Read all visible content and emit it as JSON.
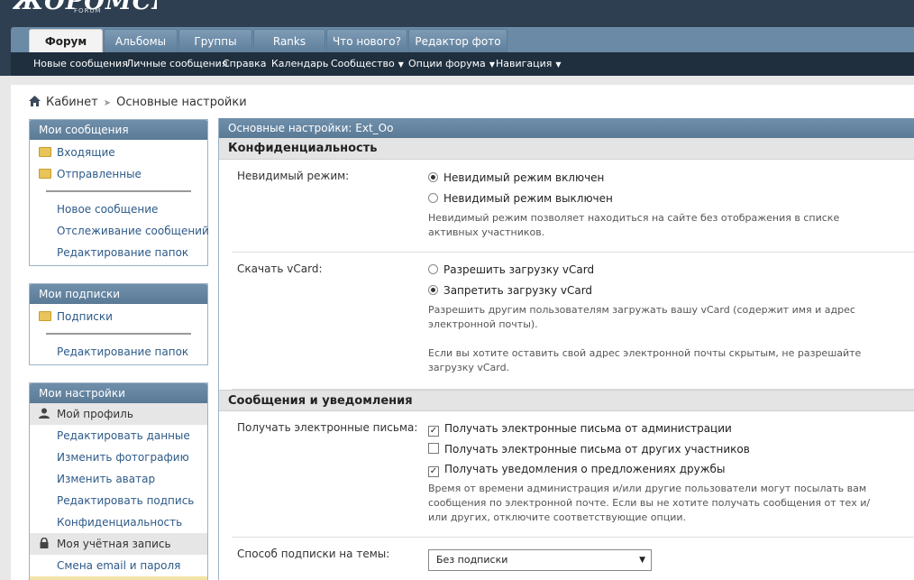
{
  "header": {
    "logo_text": "FORUM",
    "logo_sub": "FORUM",
    "tabs": [
      {
        "label": "Форум"
      },
      {
        "label": "Альбомы"
      },
      {
        "label": "Группы"
      },
      {
        "label": "Ranks"
      },
      {
        "label": "Что нового?"
      },
      {
        "label": "Редактор фото"
      }
    ],
    "subnav": [
      {
        "label": "Новые сообщения"
      },
      {
        "label": "Личные сообщения"
      },
      {
        "label": "Справка"
      },
      {
        "label": "Календарь"
      },
      {
        "label": "Сообщество"
      },
      {
        "label": "Опции форума"
      },
      {
        "label": "Навигация"
      }
    ]
  },
  "breadcrumb": {
    "home": "Кабинет",
    "current": "Основные настройки"
  },
  "sidebar": {
    "messages": {
      "title": "Мои сообщения",
      "folders": [
        "Входящие",
        "Отправленные"
      ],
      "links": [
        "Новое сообщение",
        "Отслеживание сообщений",
        "Редактирование папок"
      ]
    },
    "subscriptions": {
      "title": "Мои подписки",
      "folders": [
        "Подписки"
      ],
      "links": [
        "Редактирование папок"
      ]
    },
    "settings": {
      "title": "Мои настройки",
      "profile_label": "Мой профиль",
      "profile_links": [
        "Редактировать данные",
        "Изменить фотографию",
        "Изменить аватар",
        "Редактировать подпись",
        "Конфиденциальность"
      ],
      "account_label": "Моя учётная запись",
      "account_links": [
        "Смена email и пароля"
      ]
    }
  },
  "main": {
    "title": "Основные настройки: Ext_Oo",
    "privacy": {
      "title": "Конфиденциальность",
      "invisible": {
        "label": "Невидимый режим:",
        "options": [
          "Невидимый режим включен",
          "Невидимый режим выключен"
        ],
        "selected": 0,
        "desc": "Невидимый режим позволяет находиться на сайте без отображения в списке активных участников."
      },
      "vcard": {
        "label": "Скачать vCard:",
        "options": [
          "Разрешить загрузку vCard",
          "Запретить загрузку vCard"
        ],
        "selected": 1,
        "desc1": "Разрешить другим пользователям загружать вашу vCard (содержит имя и адрес электронной почты).",
        "desc2": "Если вы хотите оставить свой адрес электронной почты скрытым, не разрешайте загрузку vCard."
      }
    },
    "notifications": {
      "title": "Сообщения и уведомления",
      "emails": {
        "label": "Получать электронные письма:",
        "options": [
          {
            "label": "Получать электронные письма от администрации",
            "checked": true
          },
          {
            "label": "Получать электронные письма от других участников",
            "checked": false
          },
          {
            "label": "Получать уведомления о предложениях дружбы",
            "checked": true
          }
        ],
        "desc": "Время от времени администрация и/или другие пользователи могут посылать вам сообщения по электронной почте. Если вы не хотите получать сообщения от тех и/или других, отключите соответствующие опции."
      },
      "subscription": {
        "label": "Способ подписки на темы:",
        "value": "Без подписки"
      }
    }
  },
  "colors": {
    "header_bg": "#2d3f50",
    "accent": "#5a7a96",
    "link": "#2d5a88"
  }
}
